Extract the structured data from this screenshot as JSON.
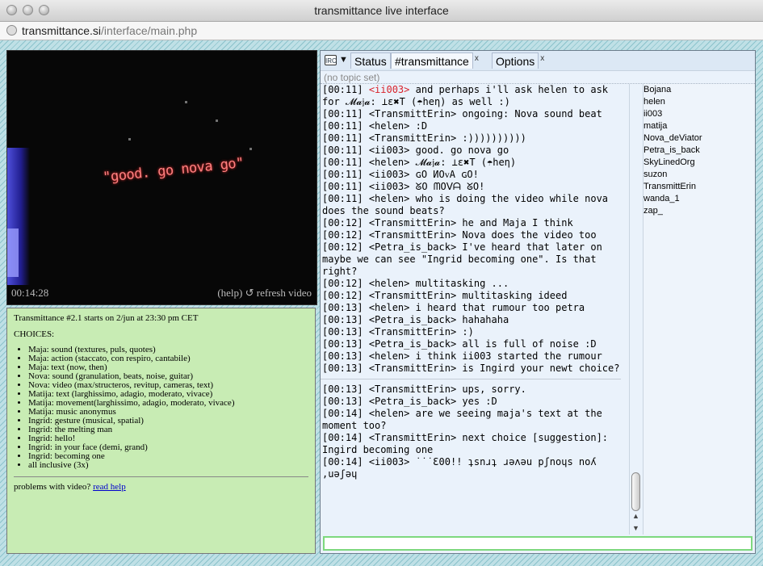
{
  "window": {
    "title": "transmittance live interface"
  },
  "address": {
    "domain": "transmittance.si",
    "path": "/interface/main.php"
  },
  "video": {
    "overlay_text": "\"good. go nova go\"",
    "time": "00:14:28",
    "help_label": "(help)",
    "refresh_label": "↺ refresh video"
  },
  "info": {
    "announcement": "Transmittance #2.1 starts on 2/jun at 23:30 pm CET",
    "choices_heading": "CHOICES:",
    "choices": [
      "Maja: sound (textures, puls, quotes)",
      "Maja: action (staccato, con respiro, cantabile)",
      "Maja: text (now, then)",
      "Nova: sound (granulation, beats, noise, guitar)",
      "Nova: video (max/structeros, revitup, cameras, text)",
      "Matija: text (larghissimo, adagio, moderato, vivace)",
      "Matija: movement(larghissimo, adagio, moderato, vivace)",
      "Matija: music anonymus",
      "Ingrid: gesture (musical, spatial)",
      "Ingrid: the melting man",
      "Ingrid: hello!",
      "Ingrid: in your face (demi, grand)",
      "Ingrid: becoming one",
      "all inclusive (3x)"
    ],
    "problem_text": "problems with video?",
    "help_link": "read help"
  },
  "chat": {
    "tabs": [
      {
        "label": "Status"
      },
      {
        "label": "#transmittance",
        "close": "x"
      },
      {
        "label": "Options",
        "close": "x"
      }
    ],
    "topic": "(no topic set)",
    "messages_before": [
      {
        "time": "[00:11]",
        "nick": "<ii003>",
        "text": " and perhaps i'll ask helen to ask for 𝓜𝓪𝔧𝓪: ⊥ɛ✖T (☂heη) as well :)",
        "red": true
      },
      {
        "time": "[00:11]",
        "nick": "<TransmittErin>",
        "text": " ongoing: Nova sound beat"
      },
      {
        "time": "[00:11]",
        "nick": "<helen>",
        "text": " :D"
      },
      {
        "time": "[00:11]",
        "nick": "<TransmittErin>",
        "text": " :))))))))))"
      },
      {
        "time": "[00:11]",
        "nick": "<ii003>",
        "text": " good. go nova go"
      },
      {
        "time": "[00:11]",
        "nick": "<helen>",
        "text": " 𝓜𝓪𝔧𝓪: ⊥ɛ✖T (☂heη)"
      },
      {
        "time": "[00:11]",
        "nick": "<ii003>",
        "text": " ɢO ИOᴠA ɢO!"
      },
      {
        "time": "[00:11]",
        "nick": "<ii003>",
        "text": " ᘜO ᗰOᐯᗩ ᘜO!"
      },
      {
        "time": "[00:11]",
        "nick": "<helen>",
        "text": " who is doing the video while nova does the sound beats?"
      },
      {
        "time": "[00:12]",
        "nick": "<TransmittErin>",
        "text": " he and Maja I think"
      },
      {
        "time": "[00:12]",
        "nick": "<TransmittErin>",
        "text": " Nova does the video too"
      },
      {
        "time": "[00:12]",
        "nick": "<Petra_is_back>",
        "text": " I've heard that later on maybe we can see \"Ingrid becoming one\". Is that right?"
      },
      {
        "time": "[00:12]",
        "nick": "<helen>",
        "text": " multitasking ..."
      },
      {
        "time": "[00:12]",
        "nick": "<TransmittErin>",
        "text": " multitasking ideed"
      },
      {
        "time": "[00:13]",
        "nick": "<helen>",
        "text": " i heard that rumour too petra"
      },
      {
        "time": "[00:13]",
        "nick": "<Petra_is_back>",
        "text": " hahahaha"
      },
      {
        "time": "[00:13]",
        "nick": "<TransmittErin>",
        "text": " :)"
      },
      {
        "time": "[00:13]",
        "nick": "<Petra_is_back>",
        "text": " all is full of noise :D"
      },
      {
        "time": "[00:13]",
        "nick": "<helen>",
        "text": " i think ii003 started the rumour"
      },
      {
        "time": "[00:13]",
        "nick": "<TransmittErin>",
        "text": " is Ingird your newt choice?"
      }
    ],
    "messages_after": [
      {
        "time": "[00:13]",
        "nick": "<TransmittErin>",
        "text": " ups, sorry."
      },
      {
        "time": "[00:13]",
        "nick": "<Petra_is_back>",
        "text": " yes :D"
      },
      {
        "time": "[00:14]",
        "nick": "<helen>",
        "text": " are we seeing maja's text at the moment too?"
      },
      {
        "time": "[00:14]",
        "nick": "<TransmittErin>",
        "text": " next choice [suggestion]: Ingird becoming one"
      },
      {
        "time": "[00:14]",
        "nick": "<ii003>",
        "text": " ˙˙˙Ɛ00!! ʇsnɹʇ ɹǝʌǝu pʃnoɥs noʎ ,uǝʃǝɥ"
      }
    ],
    "users": [
      "Bojana",
      "helen",
      "ii003",
      "matija",
      "Nova_deViator",
      "Petra_is_back",
      "SkyLinedOrg",
      "suzon",
      "TransmittErin",
      "wanda_1",
      "zap_"
    ],
    "input_value": ""
  }
}
